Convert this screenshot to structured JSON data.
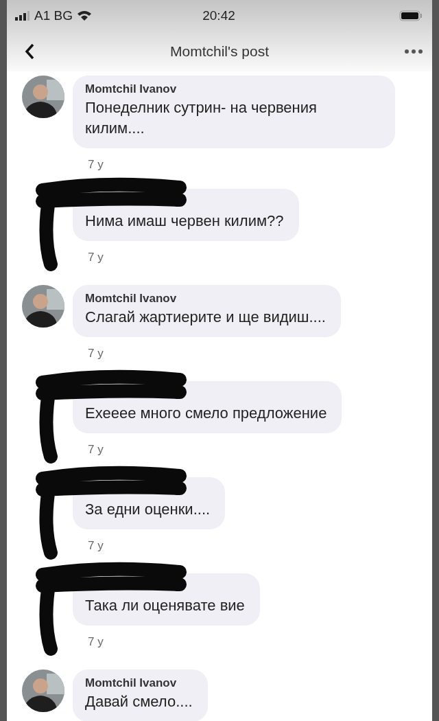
{
  "status_bar": {
    "carrier": "A1 BG",
    "time": "20:42"
  },
  "header": {
    "title": "Momtchil's post"
  },
  "comments": [
    {
      "author": "Momtchil Ivanov",
      "redacted": false,
      "text": "Понеделник сутрин- на червения килим....",
      "time": "7 y"
    },
    {
      "redacted": true,
      "text": "Нима имаш червен килим??",
      "time": "7 y"
    },
    {
      "author": "Momtchil Ivanov",
      "redacted": false,
      "text": "Слагай жартиерите и ще видиш....",
      "time": "7 y"
    },
    {
      "redacted": true,
      "text": "Ехееее много смело предложение",
      "time": "7 y"
    },
    {
      "redacted": true,
      "text": "За едни оценки....",
      "time": "7 y"
    },
    {
      "redacted": true,
      "text": "Така ли оценявате вие",
      "time": "7 y"
    },
    {
      "author": "Momtchil Ivanov",
      "redacted": false,
      "text": "Давай смело...."
    }
  ]
}
